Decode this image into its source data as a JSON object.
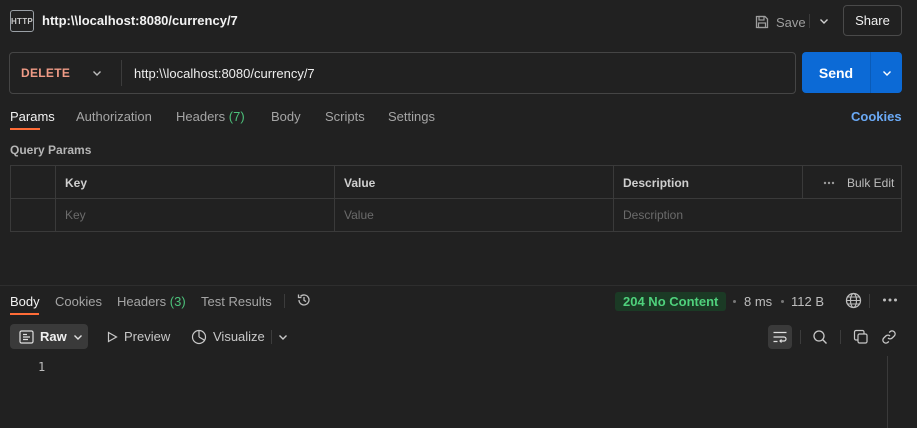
{
  "header": {
    "icon_label": "HTTP",
    "title": "http:\\\\localhost:8080/currency/7",
    "save_label": "Save",
    "share_label": "Share"
  },
  "request": {
    "method": "DELETE",
    "url": "http:\\\\localhost:8080/currency/7",
    "send_label": "Send"
  },
  "tabs": [
    {
      "label": "Params",
      "active": true
    },
    {
      "label": "Authorization"
    },
    {
      "label": "Headers",
      "count": "(7)"
    },
    {
      "label": "Body"
    },
    {
      "label": "Scripts"
    },
    {
      "label": "Settings"
    }
  ],
  "cookies_label": "Cookies",
  "query_params": {
    "title": "Query Params",
    "columns": [
      "Key",
      "Value",
      "Description"
    ],
    "bulk_edit_label": "Bulk Edit",
    "placeholders": [
      "Key",
      "Value",
      "Description"
    ]
  },
  "response": {
    "tabs": [
      {
        "label": "Body",
        "active": true
      },
      {
        "label": "Cookies"
      },
      {
        "label": "Headers",
        "count": "(3)"
      },
      {
        "label": "Test Results"
      }
    ],
    "status": "204 No Content",
    "time": "8 ms",
    "size": "112 B",
    "format_label": "Raw",
    "preview_label": "Preview",
    "visualize_label": "Visualize",
    "line_number": "1"
  },
  "colors": {
    "accent": "#ff6c37",
    "send": "#0c6ad6",
    "method_delete": "#f09b86",
    "success": "#4fd17c",
    "link": "#6aa9f5"
  },
  "icons": [
    "http-file-icon",
    "save-icon",
    "chevron-down-icon",
    "history-icon",
    "globe-icon",
    "more-icon",
    "raw-icon",
    "play-icon",
    "visualize-icon",
    "wrap-lines-icon",
    "search-icon",
    "copy-icon",
    "link-icon"
  ]
}
